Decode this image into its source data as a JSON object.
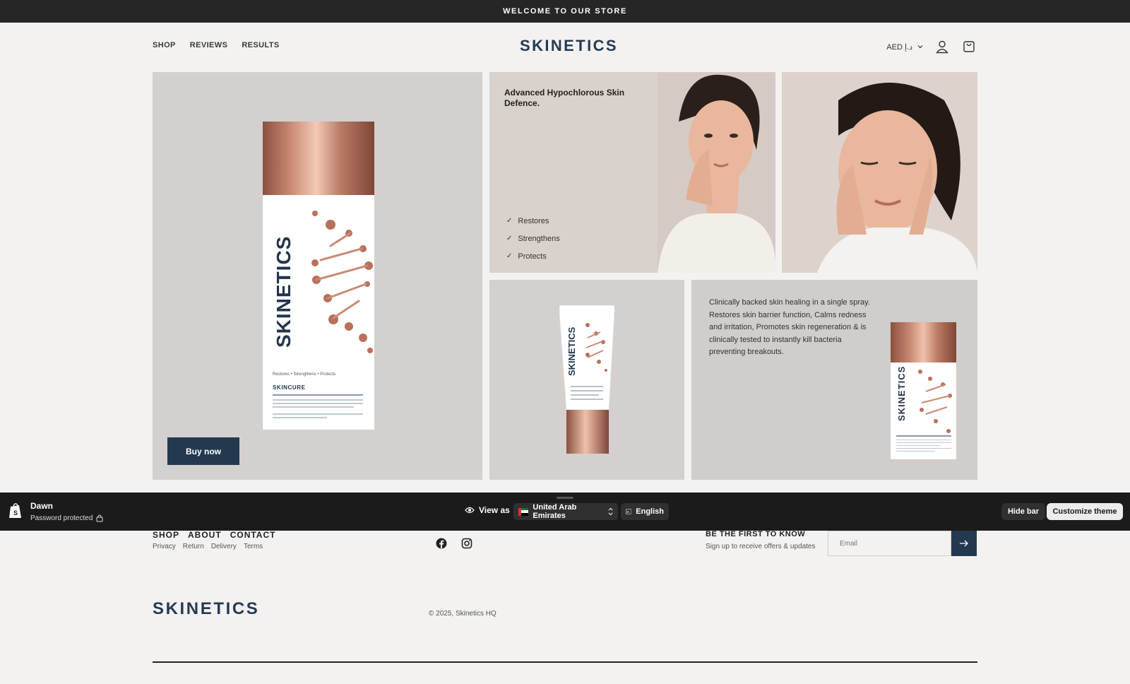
{
  "announcement": "WELCOME TO OUR STORE",
  "nav": {
    "items": [
      "SHOP",
      "REVIEWS",
      "RESULTS"
    ]
  },
  "logo": "SKINETICS",
  "header": {
    "currency": "AED د.إ",
    "account_icon": "user-icon",
    "cart_icon": "bag-icon"
  },
  "hero": {
    "buy_label": "Buy now",
    "bottle": {
      "brand": "SKINETICS",
      "tagline": "Restores • Strengthens • Protects",
      "line": "SKINCURE"
    }
  },
  "defence": {
    "title": "Advanced Hypochlorous Skin Defence.",
    "benefits": [
      "Restores",
      "Strengthens",
      "Protects"
    ]
  },
  "copy": {
    "text": "Clinically backed skin healing in a single spray. Restores skin barrier function, Calms redness and irritation, Promotes skin regeneration & is clinically tested to instantly kill bacteria preventing breakouts."
  },
  "admin_bar": {
    "store": "Dawn",
    "status": "Password protected",
    "view_as": "View as",
    "country": "United Arab Emirates",
    "language": "English",
    "hide": "Hide bar",
    "customize": "Customize theme"
  },
  "footer": {
    "menu": [
      "SHOP",
      "ABOUT",
      "CONTACT"
    ],
    "links": [
      "Privacy",
      "Return",
      "Delivery",
      "Terms"
    ],
    "social": [
      "facebook-icon",
      "instagram-icon"
    ],
    "newsletter_title": "BE THE FIRST TO KNOW",
    "newsletter_sub": "Sign up to receive offers & updates",
    "email_placeholder": "Email",
    "logo": "SKINETICS",
    "copyright": "© 2025, Skinetics HQ"
  },
  "colors": {
    "brand_navy": "#233950",
    "copper": "#c98a74",
    "admin_bg": "#1b1b1b"
  }
}
